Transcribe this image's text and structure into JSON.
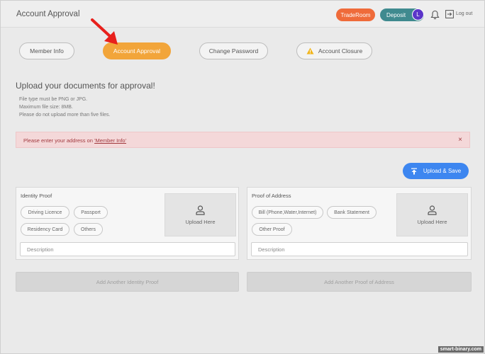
{
  "header": {
    "title": "Account Approval",
    "traderoom_label": "TradeRoom",
    "deposit_label": "Deposit",
    "avatar_initial": "L",
    "logout_label": "Log out"
  },
  "tabs": [
    {
      "label": "Member Info",
      "active": false
    },
    {
      "label": "Account Approval",
      "active": true
    },
    {
      "label": "Change Password",
      "active": false
    },
    {
      "label": "Account Closure",
      "active": false,
      "icon": "warning-icon"
    }
  ],
  "upload": {
    "title": "Upload your documents for approval!",
    "notes": [
      "File type must be PNG or JPG.",
      "Maximum file size: 8MB.",
      "Please do not upload more than five files."
    ]
  },
  "alert": {
    "text": "Please enter your address on ",
    "link": "'Member Info'",
    "close": "×"
  },
  "upload_save_label": "Upload & Save",
  "identity": {
    "title": "Identity Proof",
    "chips": [
      "Driving Licence",
      "Passport",
      "Residency Card",
      "Others"
    ],
    "upload_here": "Upload Here",
    "description_placeholder": "Description",
    "add_label": "Add Another Identity Proof"
  },
  "address": {
    "title": "Proof of Address",
    "chips": [
      "Bill (Phone,Water,Internet)",
      "Bank Statement",
      "Other Proof"
    ],
    "upload_here": "Upload Here",
    "description_placeholder": "Description",
    "add_label": "Add Another Proof of Address"
  },
  "watermark": "smart-binary.com",
  "colors": {
    "traderoom": "#ef6b3a",
    "deposit": "#3f8a8f",
    "avatar": "#5b35c9",
    "active_tab": "#f2a53a",
    "upload_save": "#3d86f0",
    "alert_bg": "#f4d8d9",
    "annotation_arrow": "#e8201c"
  }
}
